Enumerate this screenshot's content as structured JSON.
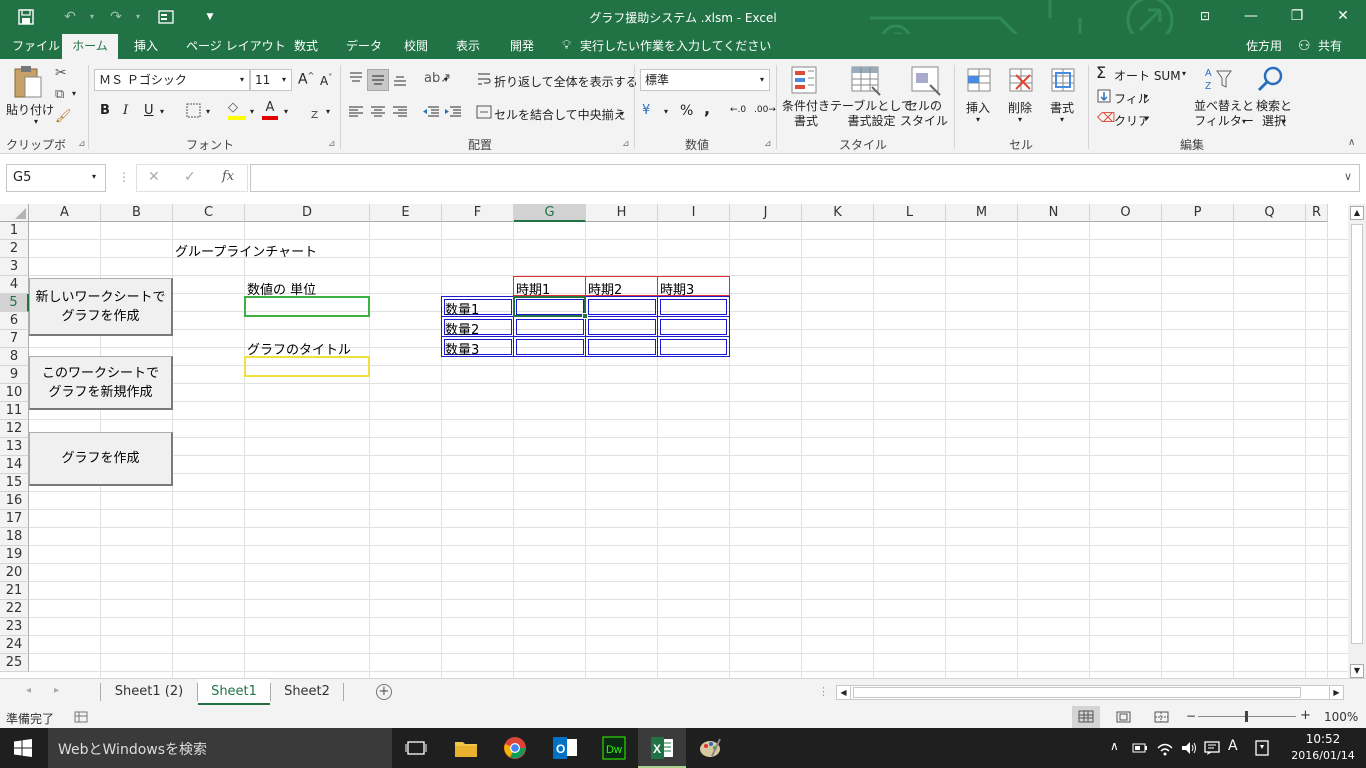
{
  "window": {
    "title": "グラフ援助システム .xlsm  -  Excel",
    "min_label": "—",
    "max_label": "❐",
    "close_label": "✕",
    "ribbon_opts_label": "⊡"
  },
  "tabs": [
    "ファイル",
    "ホーム",
    "挿入",
    "ページ レイアウト",
    "数式",
    "データ",
    "校閲",
    "表示",
    "開発"
  ],
  "tellme": "実行したい作業を入力してください",
  "user": "佐方用",
  "share": "共有",
  "ribbon": {
    "clipboard": {
      "paste": "貼り付け",
      "label": "クリップボード"
    },
    "font": {
      "name": "ＭＳ Ｐゴシック",
      "size": "11",
      "label": "フォント",
      "bold": "B",
      "italic": "I",
      "underline": "U"
    },
    "alignment": {
      "wrap": "折り返して全体を表示する",
      "merge": "セルを結合して中央揃え",
      "label": "配置"
    },
    "number": {
      "format": "標準",
      "label": "数値",
      "percent": "%",
      "comma": ","
    },
    "styles": {
      "conditional": "条件付き\n書式",
      "table": "テーブルとして\n書式設定",
      "cell_style": "セルの\nスタイル",
      "label": "スタイル"
    },
    "cells": {
      "insert": "挿入",
      "delete": "削除",
      "format": "書式",
      "label": "セル"
    },
    "editing": {
      "autosum": "オート SUM",
      "fill": "フィル",
      "clear": "クリア",
      "sort": "並べ替えと\nフィルター",
      "find": "検索と\n選択",
      "label": "編集"
    }
  },
  "formula_bar": {
    "name_box": "G5",
    "fx": "fx",
    "cancel": "✕",
    "enter": "✓",
    "value": ""
  },
  "columns": [
    "A",
    "B",
    "C",
    "D",
    "E",
    "F",
    "G",
    "H",
    "I",
    "J",
    "K",
    "L",
    "M",
    "N",
    "O",
    "P",
    "Q",
    "R"
  ],
  "rows": [
    "1",
    "2",
    "3",
    "4",
    "5",
    "6",
    "7",
    "8",
    "9",
    "10",
    "11",
    "12",
    "13",
    "14",
    "15",
    "16",
    "17",
    "18",
    "19",
    "20",
    "21",
    "22",
    "23",
    "24",
    "25"
  ],
  "cells": {
    "title": "グループラインチャート",
    "unit_label": "数値の 単位",
    "chart_title_label": "グラフのタイトル",
    "periods": [
      "時期1",
      "時期2",
      "時期3"
    ],
    "quantities": [
      "数量1",
      "数量2",
      "数量3"
    ]
  },
  "buttons": {
    "new_sheet": "新しいワークシートで\nグラフを作成",
    "this_sheet": "このワークシートで\nグラフを新規作成",
    "create": "グラフを作成"
  },
  "sheet_tabs": [
    "Sheet1 (2)",
    "Sheet1",
    "Sheet2"
  ],
  "active_sheet": "Sheet1",
  "status": {
    "ready": "準備完了",
    "zoom": "100%"
  },
  "taskbar": {
    "search_placeholder": "WebとWindowsを検索",
    "time": "10:52",
    "date": "2016/01/14",
    "ime": "A"
  },
  "colors": {
    "excel_green": "#217346",
    "header_red": "#e03030",
    "table_blue": "#1a1ad0",
    "unit_green": "#3cb043",
    "title_yellow": "#f0e040"
  }
}
